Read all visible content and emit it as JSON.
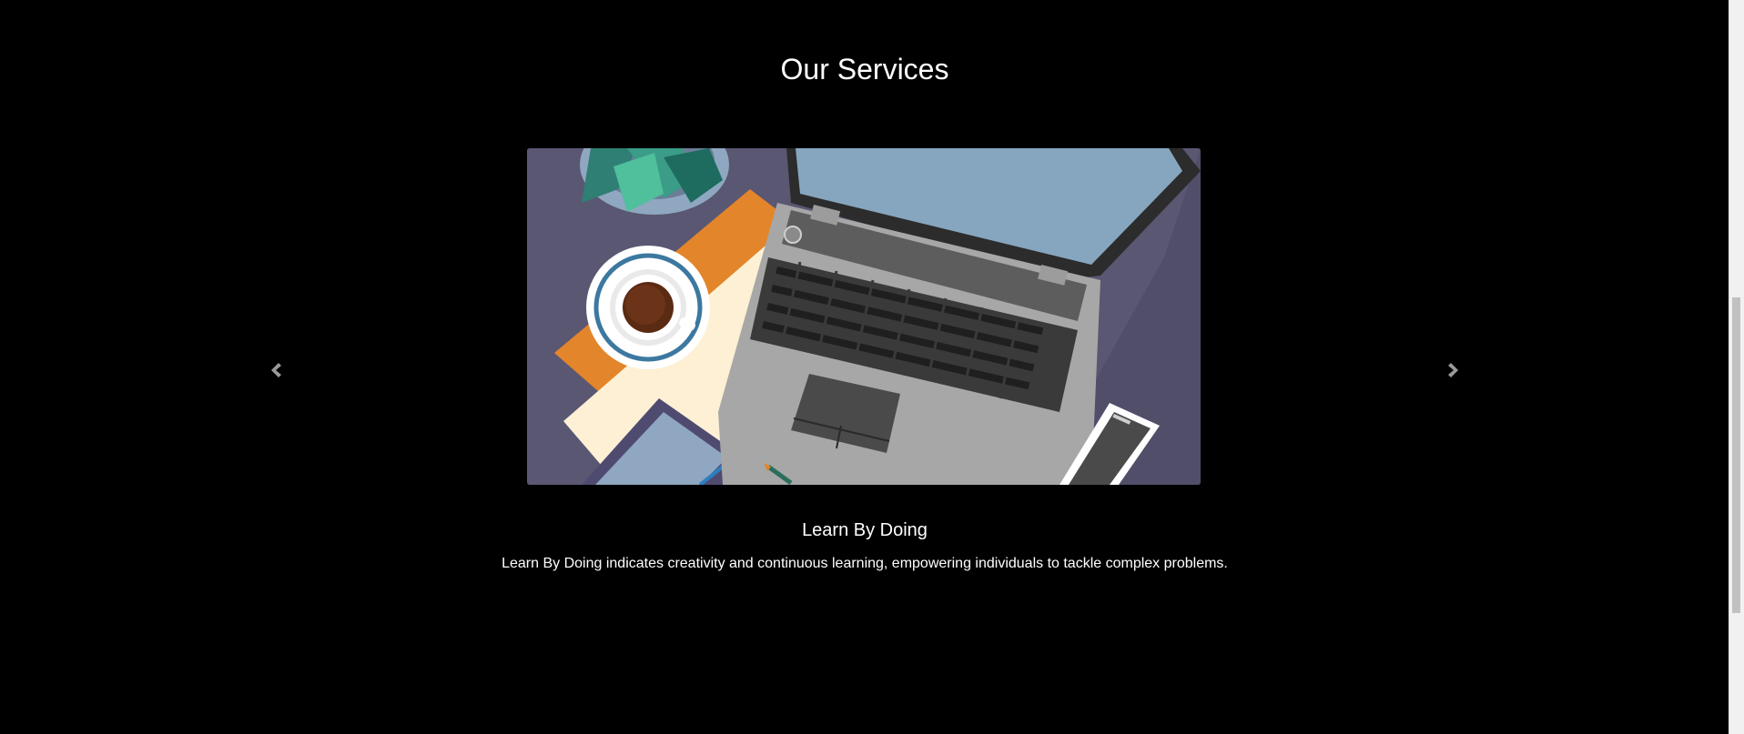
{
  "services": {
    "title": "Our Services",
    "slide": {
      "image_alt": "laptop-desk-illustration",
      "caption_title": "Learn By Doing",
      "caption_text": "Learn By Doing indicates creativity and continuous learning, empowering individuals to tackle complex problems."
    },
    "controls": {
      "prev_icon": "chevron-left-icon",
      "next_icon": "chevron-right-icon"
    }
  },
  "colors": {
    "background": "#000000",
    "text": "#ffffff",
    "control": "#9a9a9a"
  }
}
